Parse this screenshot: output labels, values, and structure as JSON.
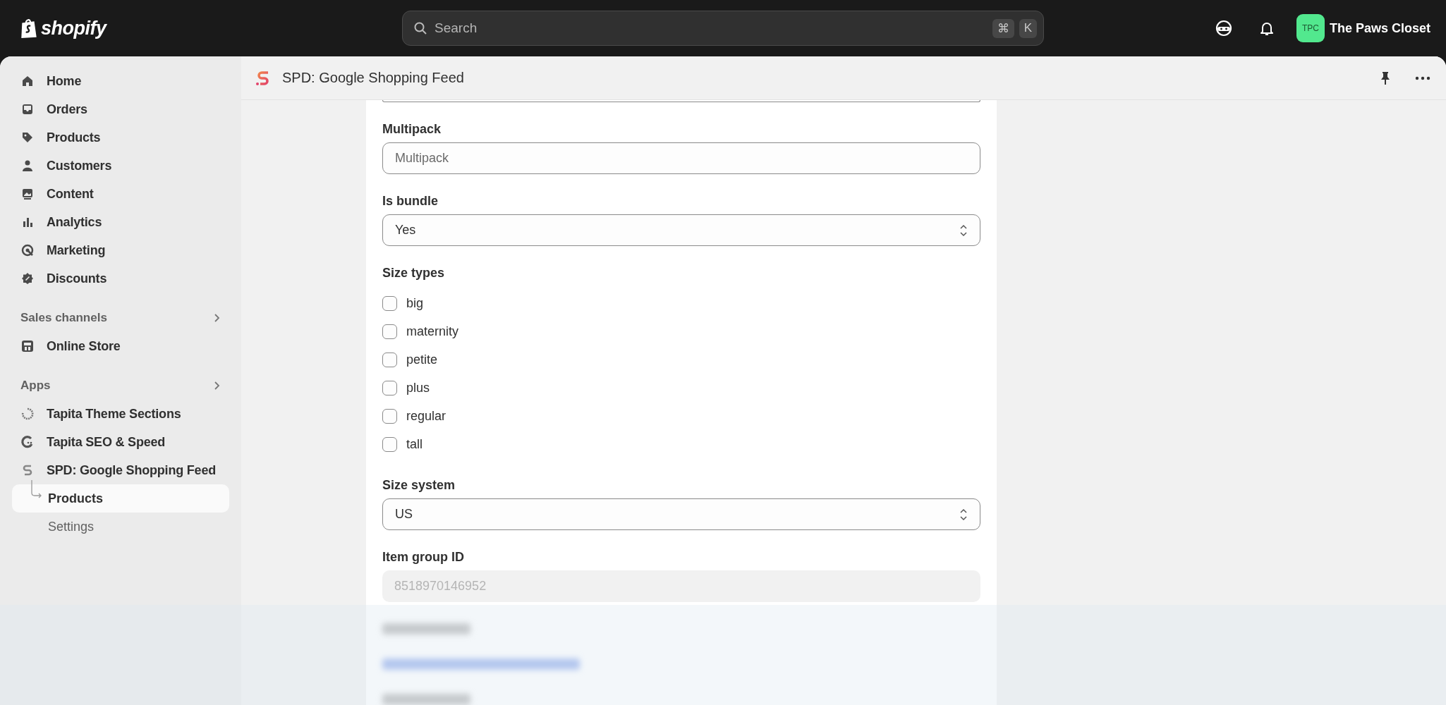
{
  "topbar": {
    "logo": "shopify",
    "search": {
      "placeholder": "Search"
    },
    "shortcut_keys": [
      "⌘",
      "K"
    ],
    "store": {
      "initials": "TPC",
      "name": "The Paws Closet"
    }
  },
  "sidebar": {
    "items": [
      {
        "label": "Home",
        "selected": false
      },
      {
        "label": "Orders",
        "selected": false
      },
      {
        "label": "Products",
        "selected": false
      },
      {
        "label": "Customers",
        "selected": false
      },
      {
        "label": "Content",
        "selected": false
      },
      {
        "label": "Analytics",
        "selected": false
      },
      {
        "label": "Marketing",
        "selected": false
      },
      {
        "label": "Discounts",
        "selected": false
      }
    ],
    "sections": [
      {
        "title": "Sales channels",
        "items": [
          {
            "label": "Online Store",
            "selected": false
          }
        ]
      },
      {
        "title": "Apps",
        "items": [
          {
            "label": "Tapita Theme Sections",
            "selected": false
          },
          {
            "label": "Tapita SEO & Speed",
            "selected": false
          },
          {
            "label": "SPD: Google Shopping Feed",
            "selected": false,
            "children": [
              {
                "label": "Products",
                "selected": true
              },
              {
                "label": "Settings",
                "selected": false
              }
            ]
          }
        ]
      }
    ]
  },
  "page": {
    "title": "SPD: Google Shopping Feed",
    "fields": [
      {
        "kind": "text",
        "label": "Multipack",
        "placeholder": "Multipack"
      },
      {
        "kind": "select",
        "label": "Is bundle",
        "value": "Yes"
      },
      {
        "kind": "checkboxes",
        "label": "Size types",
        "options": [
          {
            "label": "big",
            "checked": false
          },
          {
            "label": "maternity",
            "checked": false
          },
          {
            "label": "petite",
            "checked": false
          },
          {
            "label": "plus",
            "checked": false
          },
          {
            "label": "regular",
            "checked": false
          },
          {
            "label": "tall",
            "checked": false
          }
        ]
      },
      {
        "kind": "select",
        "label": "Size system",
        "value": "US"
      },
      {
        "kind": "readonly",
        "label": "Item group ID",
        "value": "8518970146952",
        "disabled": true
      }
    ]
  }
}
